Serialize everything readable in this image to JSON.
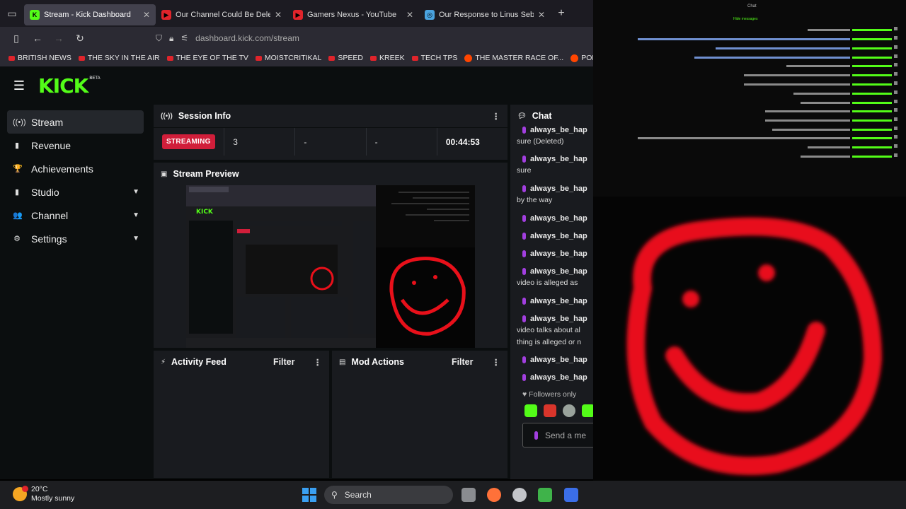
{
  "browser": {
    "tabs": [
      {
        "title": "Stream - Kick Dashboard",
        "favicon": "K",
        "favicon_color": "#53fc18",
        "active": true
      },
      {
        "title": "Our Channel Could Be Deleted",
        "favicon": "▶",
        "favicon_color": "#e0242b",
        "active": false
      },
      {
        "title": "Gamers Nexus - YouTube",
        "favicon": "▶",
        "favicon_color": "#e0242b",
        "active": false
      },
      {
        "title": "Our Response to Linus Sebastian",
        "favicon": "◎",
        "favicon_color": "#4aa3df",
        "active": false
      }
    ],
    "url": "dashboard.kick.com/stream",
    "bookmarks": [
      {
        "label": "BRITISH NEWS",
        "kind": "youtube"
      },
      {
        "label": "THE SKY IN THE AIR",
        "kind": "youtube"
      },
      {
        "label": "THE EYE OF THE TV",
        "kind": "youtube"
      },
      {
        "label": "MOISTCRITIKAL",
        "kind": "youtube"
      },
      {
        "label": "SPEED",
        "kind": "youtube"
      },
      {
        "label": "KREEK",
        "kind": "youtube"
      },
      {
        "label": "TECH TPS",
        "kind": "youtube"
      },
      {
        "label": "THE MASTER RACE OF...",
        "kind": "reddit"
      },
      {
        "label": "POLITICAL STUFF",
        "kind": "reddit"
      }
    ]
  },
  "kick": {
    "logo": "KICK",
    "beta": "BETA",
    "sidebar": [
      {
        "label": "Stream",
        "icon": "broadcast-icon",
        "glyph": "((•))",
        "active": true,
        "expandable": false
      },
      {
        "label": "Revenue",
        "icon": "revenue-icon",
        "glyph": "▮",
        "active": false,
        "expandable": false
      },
      {
        "label": "Achievements",
        "icon": "trophy-icon",
        "glyph": "🏆",
        "active": false,
        "expandable": false
      },
      {
        "label": "Studio",
        "icon": "studio-icon",
        "glyph": "▮",
        "active": false,
        "expandable": true
      },
      {
        "label": "Channel",
        "icon": "channel-icon",
        "glyph": "👥",
        "active": false,
        "expandable": true
      },
      {
        "label": "Settings",
        "icon": "gear-icon",
        "glyph": "⚙",
        "active": false,
        "expandable": true
      }
    ],
    "session": {
      "title": "Session Info",
      "status": "STREAMING",
      "viewers": "3",
      "stat_a": "-",
      "stat_b": "-",
      "duration": "00:44:53"
    },
    "preview": {
      "title": "Stream Preview"
    },
    "activity": {
      "title": "Activity Feed",
      "filter": "Filter"
    },
    "mod": {
      "title": "Mod Actions",
      "filter": "Filter"
    },
    "chat": {
      "title": "Chat",
      "messages": [
        {
          "user": "always_be_hap",
          "text": "sure (Deleted)"
        },
        {
          "user": "always_be_hap",
          "text": "sure"
        },
        {
          "user": "always_be_hap",
          "text": "by the way"
        },
        {
          "user": "always_be_hap",
          "text": ""
        },
        {
          "user": "always_be_hap",
          "text": ""
        },
        {
          "user": "always_be_hap",
          "text": ""
        },
        {
          "user": "always_be_hap",
          "text": "video is alleged as"
        },
        {
          "user": "always_be_hap",
          "text": ""
        },
        {
          "user": "always_be_hap",
          "text": "video talks about al thing is alleged or n"
        },
        {
          "user": "always_be_hap",
          "text": ""
        },
        {
          "user": "always_be_hap",
          "text": ""
        }
      ],
      "followers_only": "Followers only",
      "input_placeholder": "Send a me"
    }
  },
  "overlay": {
    "title": "Chat",
    "header": "Hide messages"
  },
  "taskbar": {
    "temperature": "20°C",
    "condition": "Mostly sunny",
    "search": "Search"
  },
  "colors": {
    "kick_green": "#53fc18",
    "streaming_red": "#d11e3a",
    "smiley_red": "#e8101a",
    "mic_purple": "#a23fe0"
  }
}
